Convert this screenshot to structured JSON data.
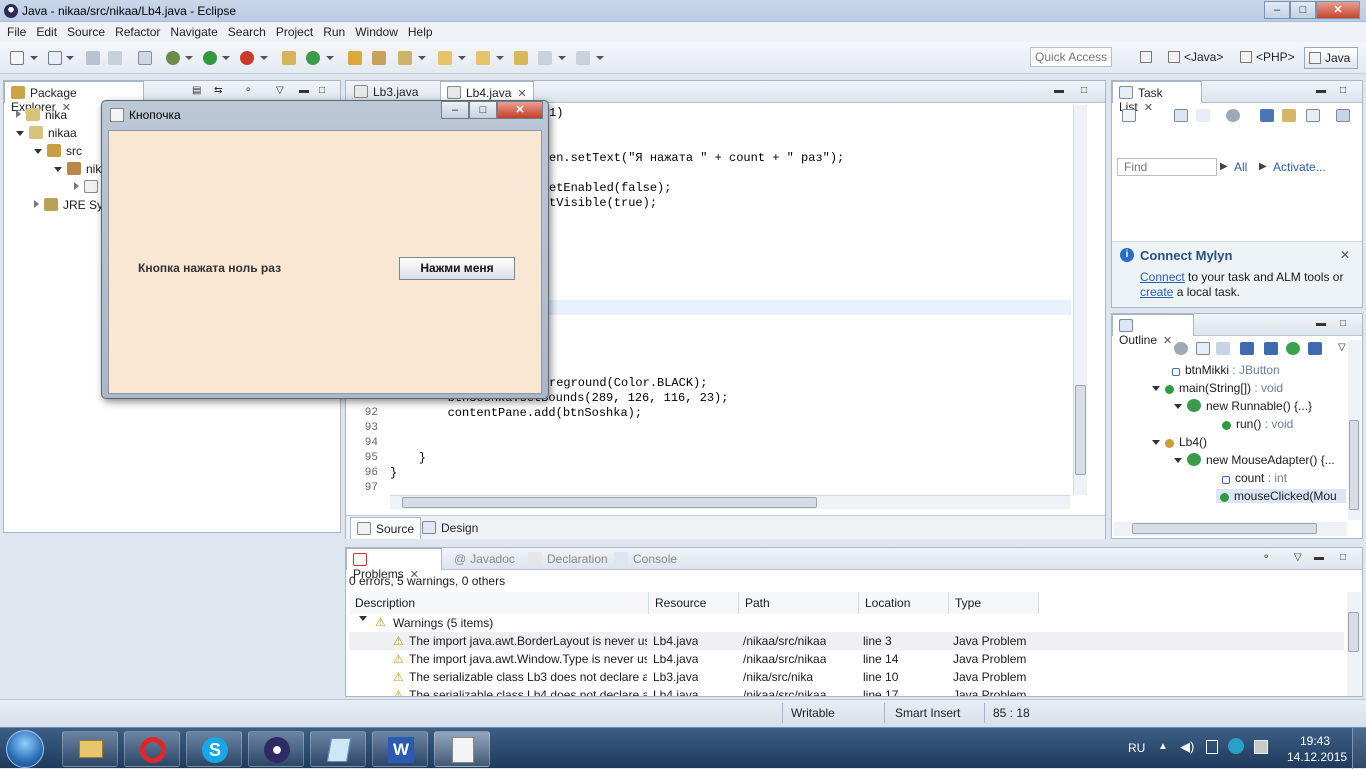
{
  "window": {
    "title": "Java - nikaa/src/nikaa/Lb4.java - Eclipse",
    "controls": [
      "–",
      "□",
      "✕"
    ]
  },
  "menu": [
    "File",
    "Edit",
    "Source",
    "Refactor",
    "Navigate",
    "Search",
    "Project",
    "Run",
    "Window",
    "Help"
  ],
  "toolbar": {
    "quick_access": "Quick Access",
    "perspectives": [
      "<Java>",
      "<PHP>",
      "Java"
    ]
  },
  "package_explorer": {
    "tab": "Package Explorer",
    "tree": [
      {
        "label": "nika",
        "level": 0,
        "state": "closed"
      },
      {
        "label": "nikaa",
        "level": 0,
        "state": "open"
      },
      {
        "label": "src",
        "level": 1,
        "state": "open"
      },
      {
        "label": "nik",
        "level": 2,
        "state": "open"
      },
      {
        "label": "",
        "level": 3,
        "state": "closed"
      },
      {
        "label": "JRE Sy",
        "level": 1,
        "state": "closed"
      }
    ]
  },
  "editor": {
    "tabs": [
      "Lb3.java",
      "Lb4.java"
    ],
    "active_tab": "Lb4.java",
    "code_fragments": [
      {
        "text": "1)",
        "line": 0
      },
      {
        "text": "en.setText(\"Я нажата \" + count + \" раз\");",
        "line": 3
      },
      {
        "text": "etEnabled(false);",
        "line": 5
      },
      {
        "text": "tVisible(true);",
        "line": 6
      },
      {
        "text": "reground(Color.BLACK);",
        "line": 18
      }
    ],
    "lines": [
      {
        "num": "92",
        "text": "        contentPane.add(btnSoshka);"
      },
      {
        "num": "93",
        "text": ""
      },
      {
        "num": "94",
        "text": ""
      },
      {
        "num": "95",
        "text": "    }"
      },
      {
        "num": "96",
        "text": "}"
      },
      {
        "num": "97",
        "text": ""
      }
    ],
    "partial_line": "        btnSoshka.setBounds(289, 126, 116, 23);",
    "bottom_tabs": [
      "Source",
      "Design"
    ]
  },
  "task_list": {
    "tab": "Task List",
    "find_placeholder": "Find",
    "filter_all": "All",
    "activate": "Activate...",
    "mylyn_title": "Connect Mylyn",
    "mylyn_connect": "Connect",
    "mylyn_mid": " to your task and ALM tools or",
    "mylyn_create": "create",
    "mylyn_end": " a local task."
  },
  "outline": {
    "tab": "Outline",
    "items": [
      {
        "label": "btnMikki",
        "type": " : JButton",
        "level": 1
      },
      {
        "label": "main(String[])",
        "type": " : void",
        "level": 0
      },
      {
        "label": "new Runnable() {...}",
        "type": "",
        "level": 1
      },
      {
        "label": "run()",
        "type": " : void",
        "level": 2
      },
      {
        "label": "Lb4()",
        "type": "",
        "level": 0
      },
      {
        "label": "new MouseAdapter() {...",
        "type": "",
        "level": 1
      },
      {
        "label": "count",
        "type": " : int",
        "level": 2
      },
      {
        "label": "mouseClicked(Mou",
        "type": "",
        "level": 2
      }
    ]
  },
  "problems": {
    "tabs": [
      "Problems",
      "Javadoc",
      "Declaration",
      "Console"
    ],
    "summary": "0 errors, 5 warnings, 0 others",
    "columns": [
      "Description",
      "Resource",
      "Path",
      "Location",
      "Type"
    ],
    "group": "Warnings (5 items)",
    "rows": [
      {
        "desc": "The import java.awt.BorderLayout is never us",
        "res": "Lb4.java",
        "path": "/nikaa/src/nikaa",
        "loc": "line 3",
        "type": "Java Problem"
      },
      {
        "desc": "The import java.awt.Window.Type is never us",
        "res": "Lb4.java",
        "path": "/nikaa/src/nikaa",
        "loc": "line 14",
        "type": "Java Problem"
      },
      {
        "desc": "The serializable class Lb3 does not declare a s",
        "res": "Lb3.java",
        "path": "/nika/src/nika",
        "loc": "line 10",
        "type": "Java Problem"
      },
      {
        "desc": "The serializable class Lb4 does not declare a s",
        "res": "Lb4.java",
        "path": "/nikaa/src/nikaa",
        "loc": "line 17",
        "type": "Java Problem"
      }
    ]
  },
  "statusbar": {
    "writable": "Writable",
    "insert": "Smart Insert",
    "position": "85 : 18"
  },
  "taskbar": {
    "lang": "RU",
    "time": "19:43",
    "date": "14.12.2015"
  },
  "dialog": {
    "title": "Кнопочка",
    "label": "Кнопка нажата ноль раз",
    "button": "Нажми меня",
    "controls": [
      "–",
      "□",
      "✕"
    ]
  }
}
